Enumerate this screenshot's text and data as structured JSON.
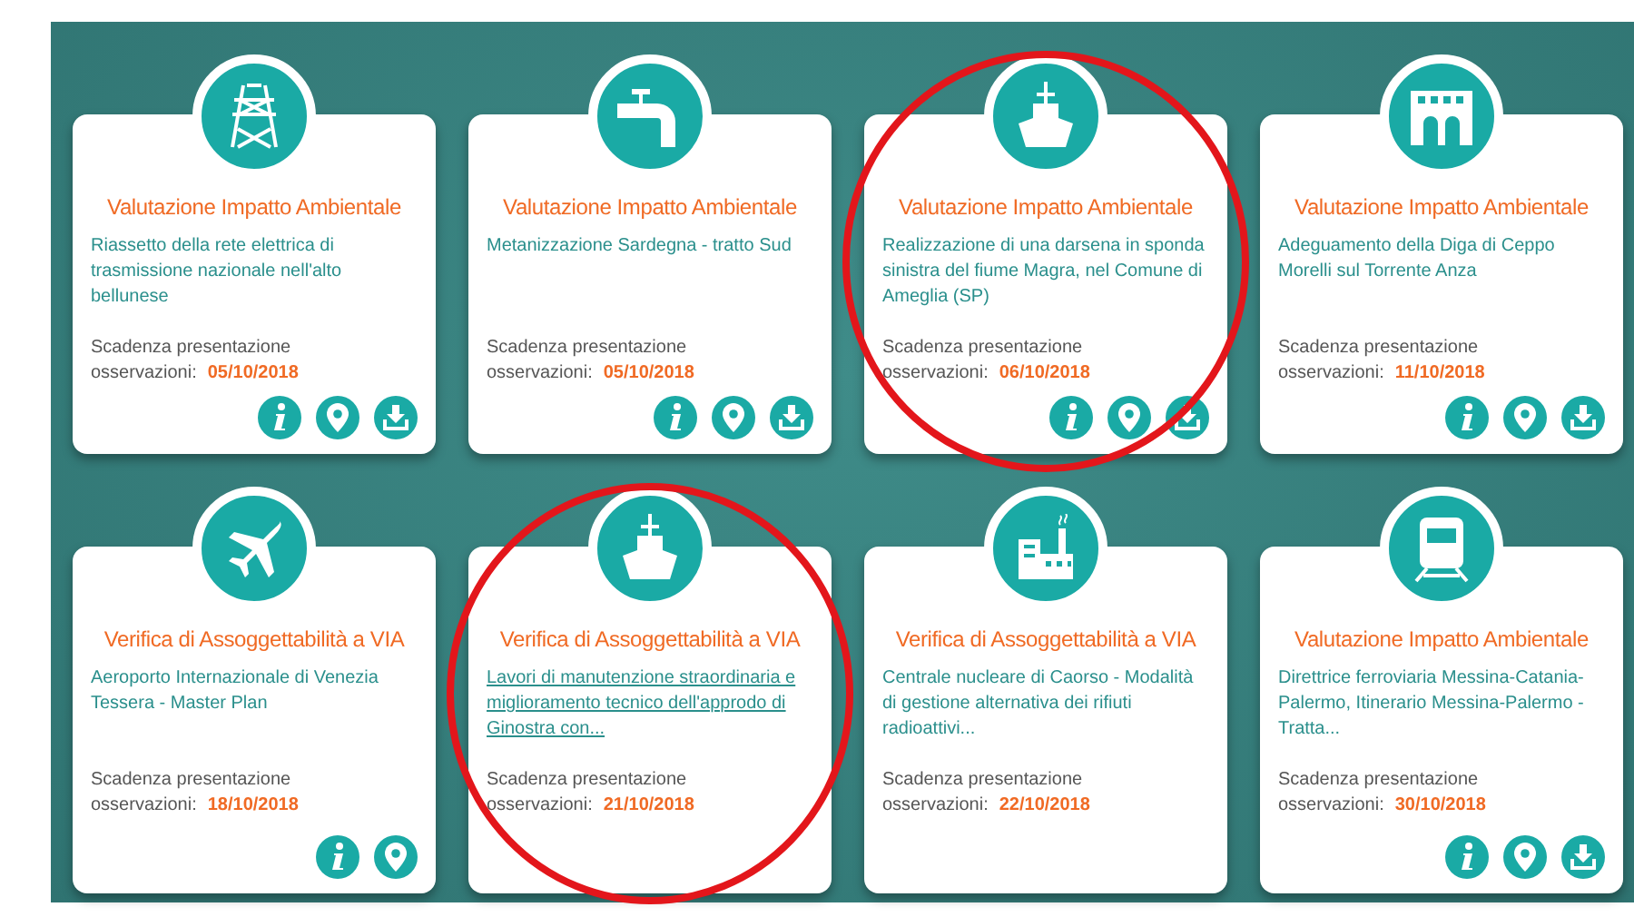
{
  "cards": [
    {
      "title": "Valutazione Impatto Ambientale",
      "description": "Riassetto della rete elettrica di trasmissione nazionale nell'alto bellunese",
      "hovered": false,
      "deadline_heading": "Scadenza presentazione",
      "deadline_label": "osservazioni:",
      "deadline": "05/10/2018",
      "actions": [
        {
          "kind": "info"
        },
        {
          "kind": "location"
        },
        {
          "kind": "download"
        }
      ],
      "highlighted": false
    },
    {
      "title": "Valutazione Impatto Ambientale",
      "description": "Metanizzazione Sardegna - tratto Sud",
      "hovered": false,
      "deadline_heading": "Scadenza presentazione",
      "deadline_label": "osservazioni:",
      "deadline": "05/10/2018",
      "actions": [
        {
          "kind": "info"
        },
        {
          "kind": "location"
        },
        {
          "kind": "download"
        }
      ],
      "highlighted": false
    },
    {
      "title": "Valutazione Impatto Ambientale",
      "description": "Realizzazione di una darsena in sponda sinistra del fiume Magra, nel Comune di Ameglia (SP)",
      "hovered": false,
      "deadline_heading": "Scadenza presentazione",
      "deadline_label": "osservazioni:",
      "deadline": "06/10/2018",
      "actions": [
        {
          "kind": "info"
        },
        {
          "kind": "location"
        },
        {
          "kind": "download"
        }
      ],
      "highlighted": true
    },
    {
      "title": "Valutazione Impatto Ambientale",
      "description": "Adeguamento della Diga di Ceppo Morelli sul Torrente Anza",
      "hovered": false,
      "deadline_heading": "Scadenza presentazione",
      "deadline_label": "osservazioni:",
      "deadline": "11/10/2018",
      "actions": [
        {
          "kind": "info"
        },
        {
          "kind": "location"
        },
        {
          "kind": "download"
        }
      ],
      "highlighted": false
    },
    {
      "title": "Verifica di Assoggettabilità a VIA",
      "description": "Aeroporto Internazionale di Venezia Tessera - Master Plan",
      "hovered": false,
      "deadline_heading": "Scadenza presentazione",
      "deadline_label": "osservazioni:",
      "deadline": "18/10/2018",
      "actions": [
        {
          "kind": "info"
        },
        {
          "kind": "location"
        }
      ],
      "highlighted": false
    },
    {
      "title": "Verifica di Assoggettabilità a VIA",
      "description": "Lavori di manutenzione straordinaria e miglioramento tecnico dell'approdo di Ginostra con...",
      "hovered": true,
      "deadline_heading": "Scadenza presentazione",
      "deadline_label": "osservazioni:",
      "deadline": "21/10/2018",
      "highlighted": true
    },
    {
      "title": "Verifica di Assoggettabilità a VIA",
      "description": "Centrale nucleare di Caorso - Modalità di gestione alternativa dei rifiuti radioattivi...",
      "hovered": false,
      "deadline_heading": "Scadenza presentazione",
      "deadline_label": "osservazioni:",
      "deadline": "22/10/2018",
      "highlighted": false
    },
    {
      "title": "Valutazione Impatto Ambientale",
      "description": "Direttrice ferroviaria Messina-Catania-Palermo, Itinerario Messina-Palermo - Tratta...",
      "hovered": false,
      "deadline_heading": "Scadenza presentazione",
      "deadline_label": "osservazioni:",
      "deadline": "30/10/2018",
      "actions": [
        {
          "kind": "info"
        },
        {
          "kind": "location"
        },
        {
          "kind": "download"
        }
      ],
      "highlighted": false
    }
  ]
}
